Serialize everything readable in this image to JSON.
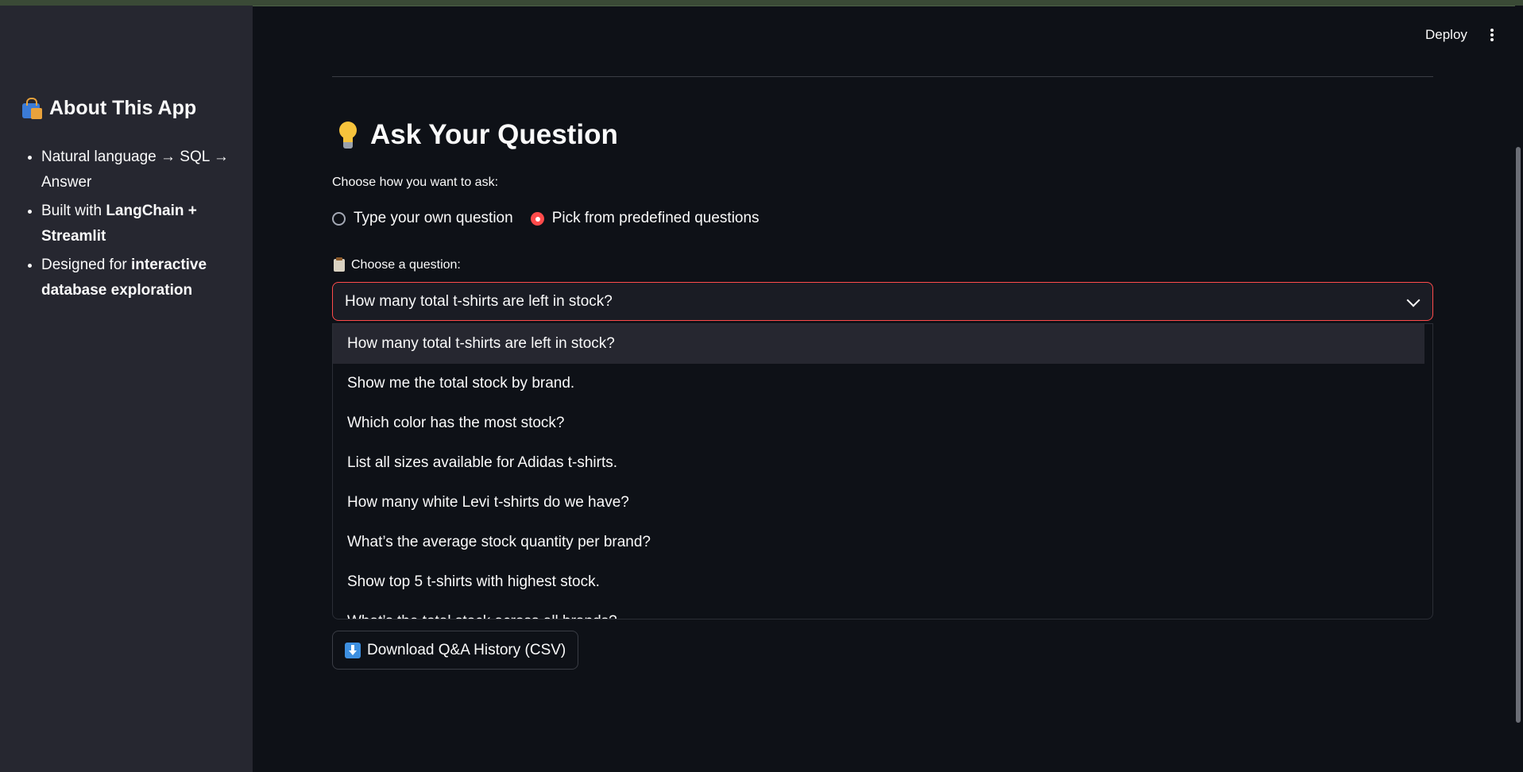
{
  "sidebar": {
    "title": "About This App",
    "title_icon": "shopping-bags-icon",
    "items": [
      {
        "text_pre": "Natural language → SQL → Answer",
        "bold": "",
        "text_post": ""
      },
      {
        "text_pre": "Built with ",
        "bold": "LangChain + Streamlit",
        "text_post": ""
      },
      {
        "text_pre": "Designed for ",
        "bold": "interactive database exploration",
        "text_post": ""
      }
    ]
  },
  "header": {
    "deploy_label": "Deploy",
    "menu_icon": "kebab-menu-icon"
  },
  "main": {
    "heading": "Ask Your Question",
    "heading_icon": "light-bulb-icon",
    "mode_label": "Choose how you want to ask:",
    "radio_options": [
      {
        "label": "Type your own question",
        "selected": false
      },
      {
        "label": "Pick from predefined questions",
        "selected": true
      }
    ],
    "select_label": "Choose a question:",
    "select_icon": "clipboard-icon",
    "select_value": "How many total t-shirts are left in stock?",
    "options": [
      "How many total t-shirts are left in stock?",
      "Show me the total stock by brand.",
      "Which color has the most stock?",
      "List all sizes available for Adidas t-shirts.",
      "How many white Levi t-shirts do we have?",
      "What’s the average stock quantity per brand?",
      "Show top 5 t-shirts with highest stock.",
      "What’s the total stock across all brands?"
    ],
    "download_label": "Download Q&A History (CSV)",
    "download_icon": "down-arrow-icon"
  },
  "colors": {
    "background": "#0e1117",
    "sidebar": "#262730",
    "accent": "#ff4b4b",
    "text": "#fafafa"
  }
}
